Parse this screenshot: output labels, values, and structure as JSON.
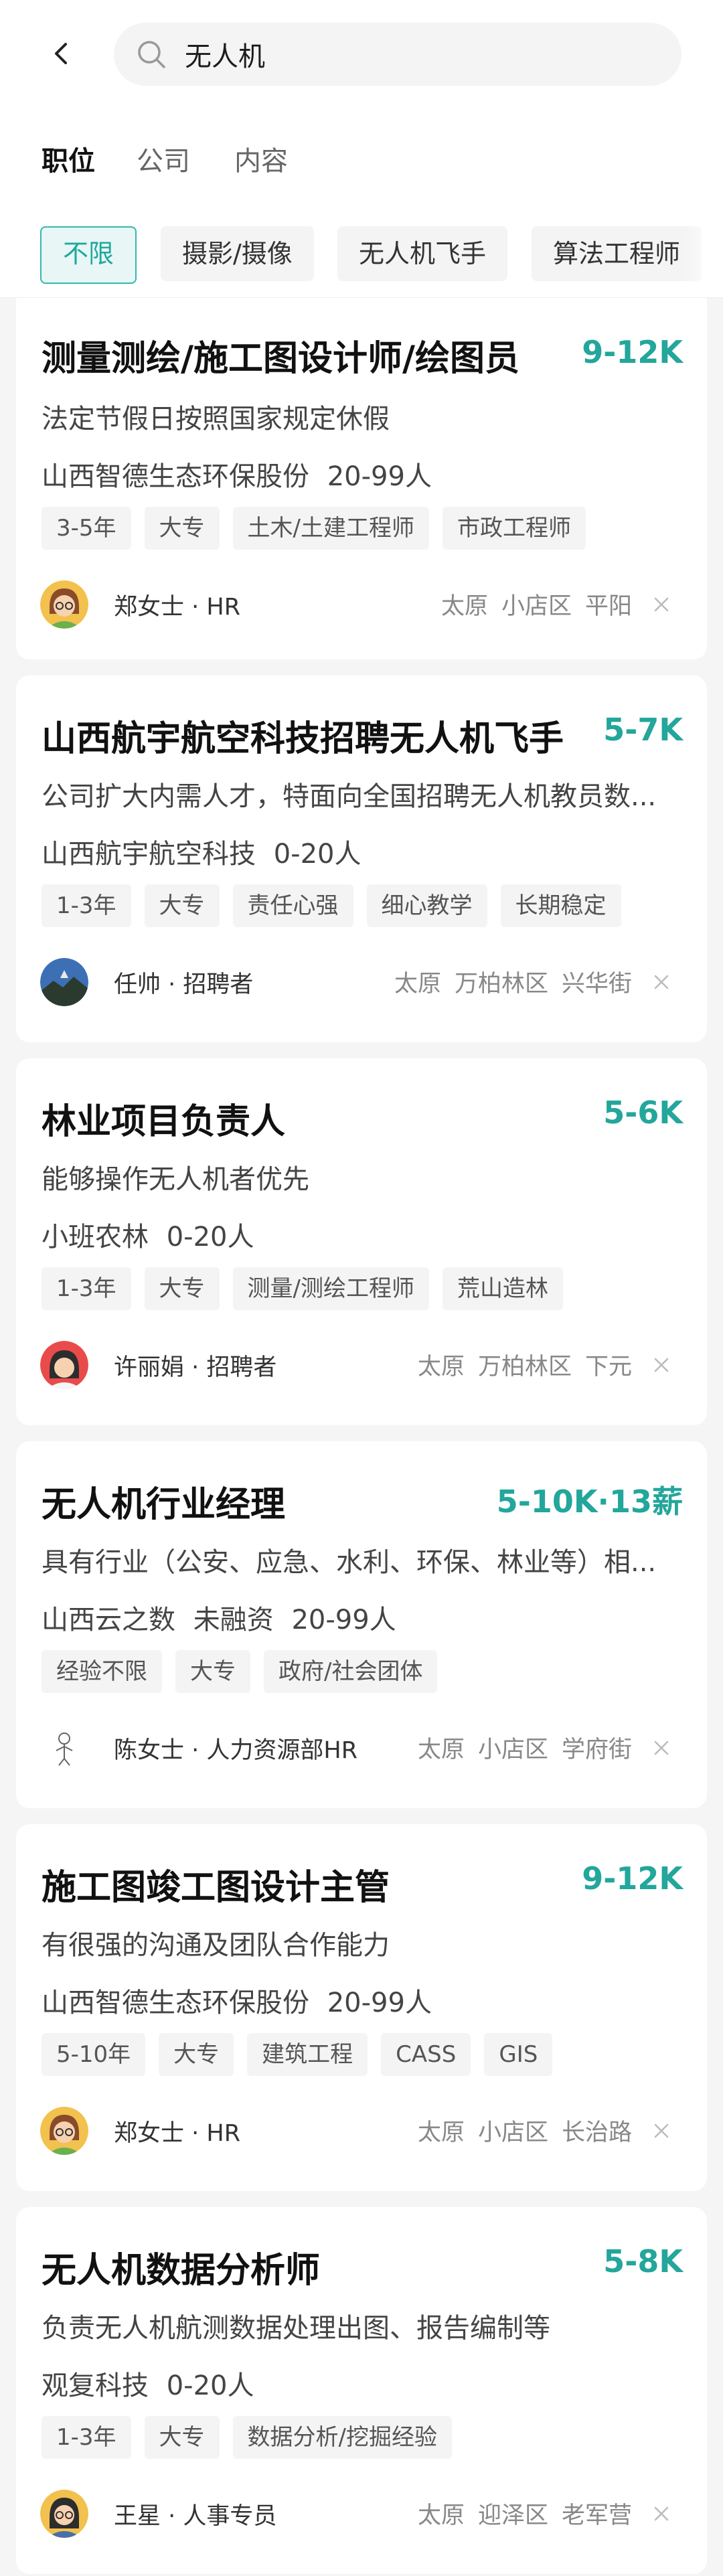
{
  "search": {
    "query": "无人机"
  },
  "tabs": [
    "职位",
    "公司",
    "内容"
  ],
  "filters": [
    "不限",
    "摄影/摄像",
    "无人机飞手",
    "算法工程师"
  ],
  "colors": {
    "accent": "#23a69b",
    "filter_active_bg": "#e8f7f6"
  },
  "jobs": [
    {
      "title": "测量测绘/施工图设计师/绘图员",
      "salary": "9-12K",
      "desc": "法定节假日按照国家规定休假",
      "company": "山西智德生态环保股份",
      "size": "20-99人",
      "tags": [
        "3-5年",
        "大专",
        "土木/土建工程师",
        "市政工程师"
      ],
      "recruiter": "郑女士 · HR",
      "avatar_icon": "woman-glasses-avatar",
      "location": [
        "太原",
        "小店区",
        "平阳"
      ]
    },
    {
      "title": "山西航宇航空科技招聘无人机飞手",
      "salary": "5-7K",
      "desc": "公司扩大内需人才，特面向全国招聘无人机教员数...",
      "company": "山西航宇航空科技",
      "size": "0-20人",
      "tags": [
        "1-3年",
        "大专",
        "责任心强",
        "细心教学",
        "长期稳定"
      ],
      "recruiter": "任帅 · 招聘者",
      "avatar_icon": "landscape-photo-avatar",
      "location": [
        "太原",
        "万柏林区",
        "兴华街"
      ]
    },
    {
      "title": "林业项目负责人",
      "salary": "5-6K",
      "desc": "能够操作无人机者优先",
      "company": "小班农林",
      "size": "0-20人",
      "tags": [
        "1-3年",
        "大专",
        "测量/测绘工程师",
        "荒山造林"
      ],
      "recruiter": "许丽娟 · 招聘者",
      "avatar_icon": "woman-avatar",
      "location": [
        "太原",
        "万柏林区",
        "下元"
      ]
    },
    {
      "title": "无人机行业经理",
      "salary": "5-10K·13薪",
      "desc": "具有行业（公安、应急、水利、环保、林业等）相...",
      "company": "山西云之数",
      "stage": "未融资",
      "size": "20-99人",
      "tags": [
        "经验不限",
        "大专",
        "政府/社会团体"
      ],
      "recruiter": "陈女士 · 人力资源部HR",
      "avatar_icon": "sketch-figure-avatar",
      "location": [
        "太原",
        "小店区",
        "学府街"
      ]
    },
    {
      "title": "施工图竣工图设计主管",
      "salary": "9-12K",
      "desc": "有很强的沟通及团队合作能力",
      "company": "山西智德生态环保股份",
      "size": "20-99人",
      "tags": [
        "5-10年",
        "大专",
        "建筑工程",
        "CASS",
        "GIS"
      ],
      "recruiter": "郑女士 · HR",
      "avatar_icon": "woman-glasses-avatar",
      "location": [
        "太原",
        "小店区",
        "长治路"
      ]
    },
    {
      "title": "无人机数据分析师",
      "salary": "5-8K",
      "desc": "负责无人机航测数据处理出图、报告编制等",
      "company": "观复科技",
      "size": "0-20人",
      "tags": [
        "1-3年",
        "大专",
        "数据分析/挖掘经验"
      ],
      "recruiter": "王星 · 人事专员",
      "avatar_icon": "woman-glasses-avatar",
      "location": [
        "太原",
        "迎泽区",
        "老军营"
      ]
    }
  ]
}
